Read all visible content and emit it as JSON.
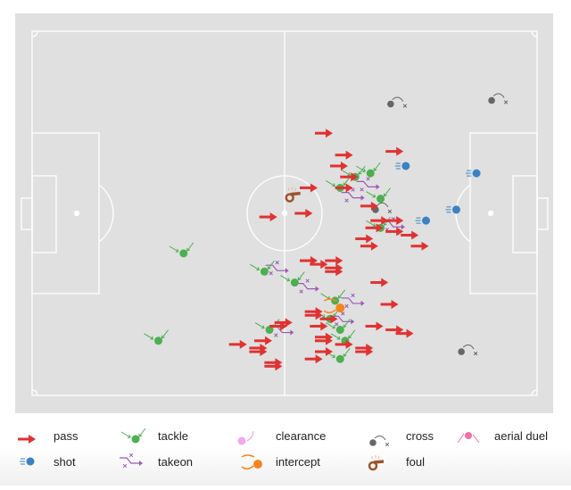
{
  "chart_data": {
    "type": "scatter",
    "pitch": {
      "x_range": [
        0,
        100
      ],
      "y_range": [
        0,
        100
      ],
      "attack_direction": "left-to-right"
    },
    "colors": {
      "pass": "#e03232",
      "tackle": "#4caf50",
      "takeon": "#9b59b6",
      "shot": "#3b82c4",
      "clearance": "#f0a8f0",
      "intercept": "#f5841f",
      "cross": "#666666",
      "foul": "#a0522d",
      "aerial_duel": "#f06fa8",
      "pitch": "#e0e0e0",
      "lines": "#ffffff"
    },
    "events": {
      "pass": [
        [
          56,
          28
        ],
        [
          60,
          34
        ],
        [
          59,
          37
        ],
        [
          70,
          33
        ],
        [
          61,
          40
        ],
        [
          53,
          43
        ],
        [
          60,
          43
        ],
        [
          65,
          48
        ],
        [
          45,
          51
        ],
        [
          52,
          50
        ],
        [
          67,
          52
        ],
        [
          70,
          52
        ],
        [
          66,
          54
        ],
        [
          70,
          55
        ],
        [
          73,
          56
        ],
        [
          64,
          57
        ],
        [
          65,
          59
        ],
        [
          75,
          59
        ],
        [
          53,
          63
        ],
        [
          55,
          64
        ],
        [
          58,
          63
        ],
        [
          58,
          65
        ],
        [
          58,
          66
        ],
        [
          67,
          69
        ],
        [
          69,
          75
        ],
        [
          54,
          77
        ],
        [
          54,
          78
        ],
        [
          57,
          79
        ],
        [
          66,
          81
        ],
        [
          55,
          81
        ],
        [
          70,
          82
        ],
        [
          72,
          83
        ],
        [
          48,
          80
        ],
        [
          47,
          81
        ],
        [
          39,
          86
        ],
        [
          44,
          85
        ],
        [
          43,
          87
        ],
        [
          43,
          88
        ],
        [
          56,
          84
        ],
        [
          56,
          85
        ],
        [
          60,
          86
        ],
        [
          64,
          87
        ],
        [
          64,
          88
        ],
        [
          56,
          88
        ],
        [
          54,
          90
        ],
        [
          46,
          91
        ],
        [
          46,
          92
        ]
      ],
      "tackle": [
        [
          64,
          40
        ],
        [
          67,
          39
        ],
        [
          61,
          43
        ],
        [
          69,
          46
        ],
        [
          69,
          54
        ],
        [
          30,
          61
        ],
        [
          46,
          66
        ],
        [
          52,
          69
        ],
        [
          60,
          74
        ],
        [
          59,
          79
        ],
        [
          61,
          82
        ],
        [
          62,
          85
        ],
        [
          47,
          82
        ],
        [
          61,
          90
        ],
        [
          25,
          85
        ]
      ],
      "takeon": [
        [
          66,
          42
        ],
        [
          63,
          45
        ],
        [
          71,
          53
        ],
        [
          48,
          65
        ],
        [
          54,
          70
        ],
        [
          63,
          74
        ],
        [
          61,
          79
        ],
        [
          49,
          82
        ]
      ],
      "shot": [
        [
          74,
          37
        ],
        [
          88,
          39
        ],
        [
          78,
          52
        ],
        [
          84,
          49
        ]
      ],
      "cross": [
        [
          71,
          20
        ],
        [
          91,
          19
        ],
        [
          68,
          49
        ],
        [
          85,
          88
        ]
      ],
      "intercept": [
        [
          61,
          76
        ]
      ],
      "foul": [
        [
          51,
          45
        ]
      ],
      "clearance": [],
      "aerial_duel": []
    },
    "legend": {
      "placement": "bottom",
      "items": [
        {
          "key": "pass",
          "label": "pass"
        },
        {
          "key": "tackle",
          "label": "tackle"
        },
        {
          "key": "clearance",
          "label": "clearance"
        },
        {
          "key": "cross",
          "label": "cross"
        },
        {
          "key": "aerial_duel",
          "label": "aerial duel"
        },
        {
          "key": "shot",
          "label": "shot"
        },
        {
          "key": "takeon",
          "label": "takeon"
        },
        {
          "key": "intercept",
          "label": "intercept"
        },
        {
          "key": "foul",
          "label": "foul"
        }
      ]
    }
  }
}
